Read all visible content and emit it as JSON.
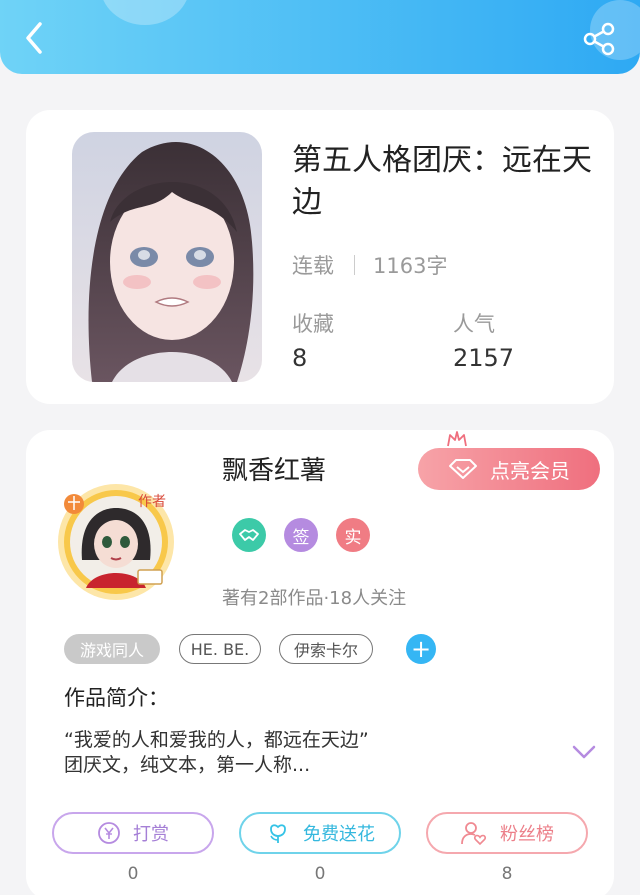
{
  "header": {
    "back_icon": "back-chevron-icon",
    "share_icon": "share-icon"
  },
  "book": {
    "title": "第五人格团厌：远在天边",
    "status": "连载",
    "word_count": "1163字",
    "favorites_label": "收藏",
    "favorites_value": "8",
    "popularity_label": "人气",
    "popularity_value": "2157"
  },
  "author": {
    "name": "飘香红薯",
    "avatar_badge": "作者",
    "vip_button": "点亮会员",
    "badge_sign": "签",
    "badge_real": "实",
    "works_info": "著有2部作品·18人关注"
  },
  "tags": [
    "游戏同人",
    "HE. BE.",
    "伊索卡尔"
  ],
  "intro": {
    "title": "作品简介：",
    "line1": "“我爱的人和爱我的人，都远在天边”",
    "line2": "团厌文，纯文本，第一人称..."
  },
  "actions": {
    "tip_label": "打赏",
    "tip_count": "0",
    "flower_label": "免费送花",
    "flower_count": "0",
    "fans_label": "粉丝榜",
    "fans_count": "8"
  },
  "colors": {
    "header_gradient_start": "#6fd3f7",
    "header_gradient_end": "#2ea9f3",
    "vip_pink": "#ef6f7e",
    "tip_purple": "#b58be0",
    "flower_cyan": "#35c3e6",
    "fans_pink": "#f08a92"
  }
}
